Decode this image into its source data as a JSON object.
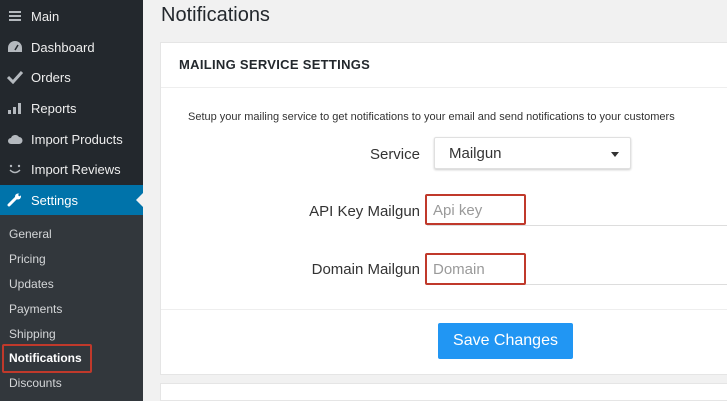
{
  "sidebar": {
    "items": [
      {
        "label": "Main",
        "icon": "menu-icon"
      },
      {
        "label": "Dashboard",
        "icon": "dashboard-icon"
      },
      {
        "label": "Orders",
        "icon": "checkmark-icon"
      },
      {
        "label": "Reports",
        "icon": "chart-icon"
      },
      {
        "label": "Import Products",
        "icon": "cloud-icon"
      },
      {
        "label": "Import Reviews",
        "icon": "smile-icon"
      },
      {
        "label": "Settings",
        "icon": "wrench-icon"
      }
    ],
    "submenu": [
      "General",
      "Pricing",
      "Updates",
      "Payments",
      "Shipping",
      "Notifications",
      "Discounts"
    ]
  },
  "page": {
    "title": "Notifications"
  },
  "panel": {
    "title": "MAILING SERVICE SETTINGS",
    "description": "Setup your mailing service to get notifications to your email and send notifications to your customers",
    "service_label": "Service",
    "service_value": "Mailgun",
    "api_key_label": "API Key Mailgun",
    "api_key_placeholder": "Api key",
    "domain_label": "Domain Mailgun",
    "domain_placeholder": "Domain",
    "save_label": "Save Changes"
  },
  "colors": {
    "sidebar_bg": "#23282d",
    "active_bg": "#0073aa",
    "button_bg": "#2196f3",
    "highlight": "#c0392b"
  }
}
